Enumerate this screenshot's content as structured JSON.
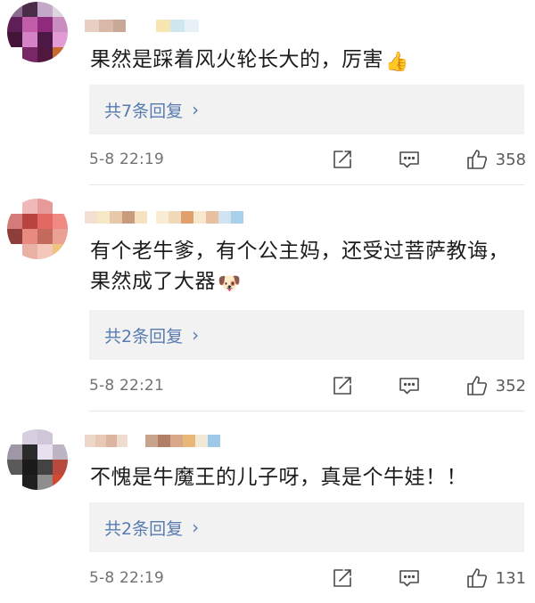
{
  "comments": [
    {
      "text": "果然是踩着风火轮长大的，厉害",
      "emoji": "👍",
      "reply_summary": "共7条回复",
      "reply_chevron": "›",
      "timestamp": "5-8 22:19",
      "likes": "358"
    },
    {
      "text": "有个老牛爹，有个公主妈，还受过菩萨教诲，果然成了大器",
      "emoji": "🐶",
      "reply_summary": "共2条回复",
      "reply_chevron": "›",
      "timestamp": "5-8 22:21",
      "likes": "352"
    },
    {
      "text": "不愧是牛魔王的儿子呀，真是个牛娃！！",
      "emoji": "",
      "reply_summary": "共2条回复",
      "reply_chevron": "›",
      "timestamp": "5-8 22:19",
      "likes": "131"
    }
  ],
  "icons": {
    "share": "share-icon",
    "reply": "comment-icon",
    "like": "thumbs-up-icon"
  },
  "colors": {
    "link": "#577bb0",
    "meta_text": "#727272",
    "reply_background": "#f2f2f2",
    "icon_stroke": "#4a4a4a",
    "divider": "#e8e8e8"
  }
}
